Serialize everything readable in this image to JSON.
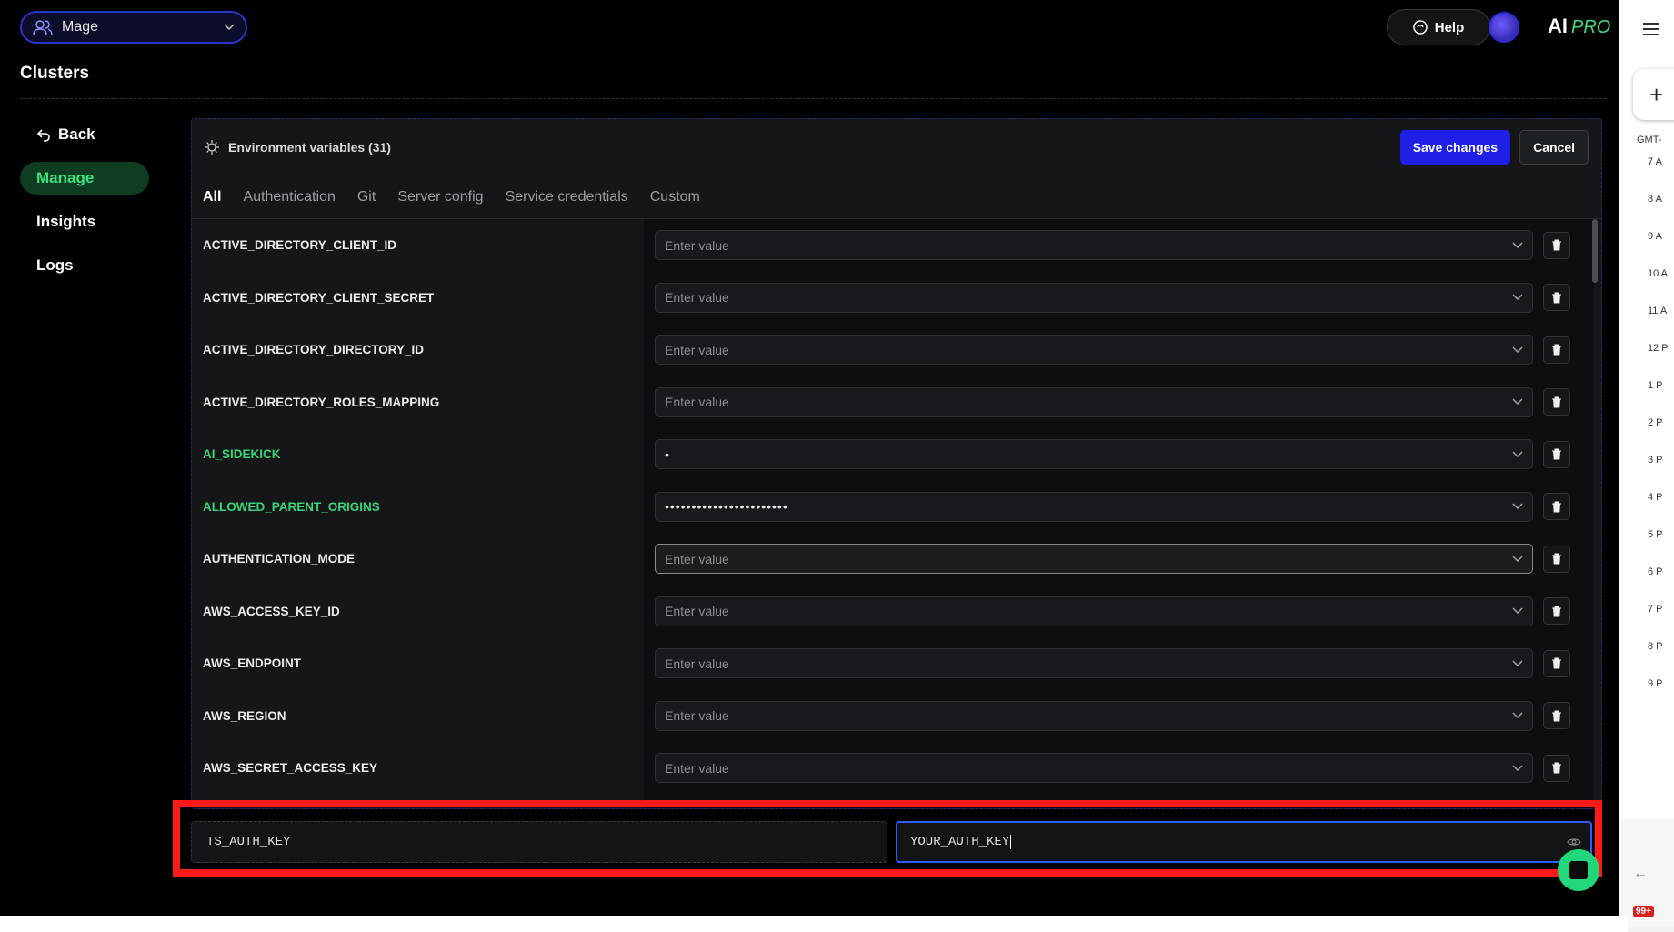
{
  "workspace": {
    "label": "Mage"
  },
  "header": {
    "help_label": "Help",
    "logo_text": "AI",
    "logo_pro": "PRO"
  },
  "page": {
    "title": "Clusters"
  },
  "sidebar": {
    "items": [
      {
        "label": "Back"
      },
      {
        "label": "Manage",
        "active": true
      },
      {
        "label": "Insights"
      },
      {
        "label": "Logs"
      }
    ]
  },
  "panel": {
    "title": "Environment variables (31)",
    "save_label": "Save changes",
    "cancel_label": "Cancel",
    "tabs": [
      {
        "label": "All",
        "active": true
      },
      {
        "label": "Authentication"
      },
      {
        "label": "Git"
      },
      {
        "label": "Server config"
      },
      {
        "label": "Service credentials"
      },
      {
        "label": "Custom"
      }
    ],
    "placeholder": "Enter value",
    "rows": [
      {
        "key": "ACTIVE_DIRECTORY_CLIENT_ID",
        "value": ""
      },
      {
        "key": "ACTIVE_DIRECTORY_CLIENT_SECRET",
        "value": ""
      },
      {
        "key": "ACTIVE_DIRECTORY_DIRECTORY_ID",
        "value": ""
      },
      {
        "key": "ACTIVE_DIRECTORY_ROLES_MAPPING",
        "value": ""
      },
      {
        "key": "AI_SIDEKICK",
        "value": "•",
        "set": true
      },
      {
        "key": "ALLOWED_PARENT_ORIGINS",
        "value": "•••••••••••••••••••••••",
        "set": true
      },
      {
        "key": "AUTHENTICATION_MODE",
        "value": "",
        "focused": true
      },
      {
        "key": "AWS_ACCESS_KEY_ID",
        "value": ""
      },
      {
        "key": "AWS_ENDPOINT",
        "value": ""
      },
      {
        "key": "AWS_REGION",
        "value": ""
      },
      {
        "key": "AWS_SECRET_ACCESS_KEY",
        "value": ""
      }
    ]
  },
  "new_variable": {
    "key": "TS_AUTH_KEY",
    "value": "YOUR_AUTH_KEY"
  },
  "right_panel": {
    "timezone": "GMT-",
    "hours": [
      "7 A",
      "8 A",
      "9 A",
      "10 A",
      "11 A",
      "12 P",
      "1 P",
      "2 P",
      "3 P",
      "4 P",
      "5 P",
      "6 P",
      "7 P",
      "8 P",
      "9 P"
    ],
    "badge": "99+"
  },
  "colors": {
    "accent": "#1f1fe6",
    "green": "#38d67a",
    "highlight": "#ff1a1a"
  }
}
